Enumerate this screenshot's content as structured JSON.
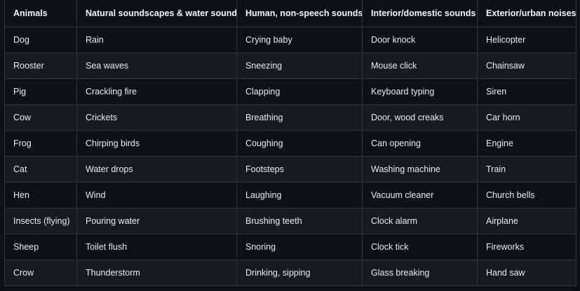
{
  "table": {
    "headers": [
      "Animals",
      "Natural soundscapes & water sounds",
      "Human, non-speech sounds",
      "Interior/domestic sounds",
      "Exterior/urban noises"
    ],
    "rows": [
      [
        "Dog",
        "Rain",
        "Crying baby",
        "Door knock",
        "Helicopter"
      ],
      [
        "Rooster",
        "Sea waves",
        "Sneezing",
        "Mouse click",
        "Chainsaw"
      ],
      [
        "Pig",
        "Crackling fire",
        "Clapping",
        "Keyboard typing",
        "Siren"
      ],
      [
        "Cow",
        "Crickets",
        "Breathing",
        "Door, wood creaks",
        "Car horn"
      ],
      [
        "Frog",
        "Chirping birds",
        "Coughing",
        "Can opening",
        "Engine"
      ],
      [
        "Cat",
        "Water drops",
        "Footsteps",
        "Washing machine",
        "Train"
      ],
      [
        "Hen",
        "Wind",
        "Laughing",
        "Vacuum cleaner",
        "Church bells"
      ],
      [
        "Insects (flying)",
        "Pouring water",
        "Brushing teeth",
        "Clock alarm",
        "Airplane"
      ],
      [
        "Sheep",
        "Toilet flush",
        "Snoring",
        "Clock tick",
        "Fireworks"
      ],
      [
        "Crow",
        "Thunderstorm",
        "Drinking, sipping",
        "Glass breaking",
        "Hand saw"
      ]
    ]
  }
}
